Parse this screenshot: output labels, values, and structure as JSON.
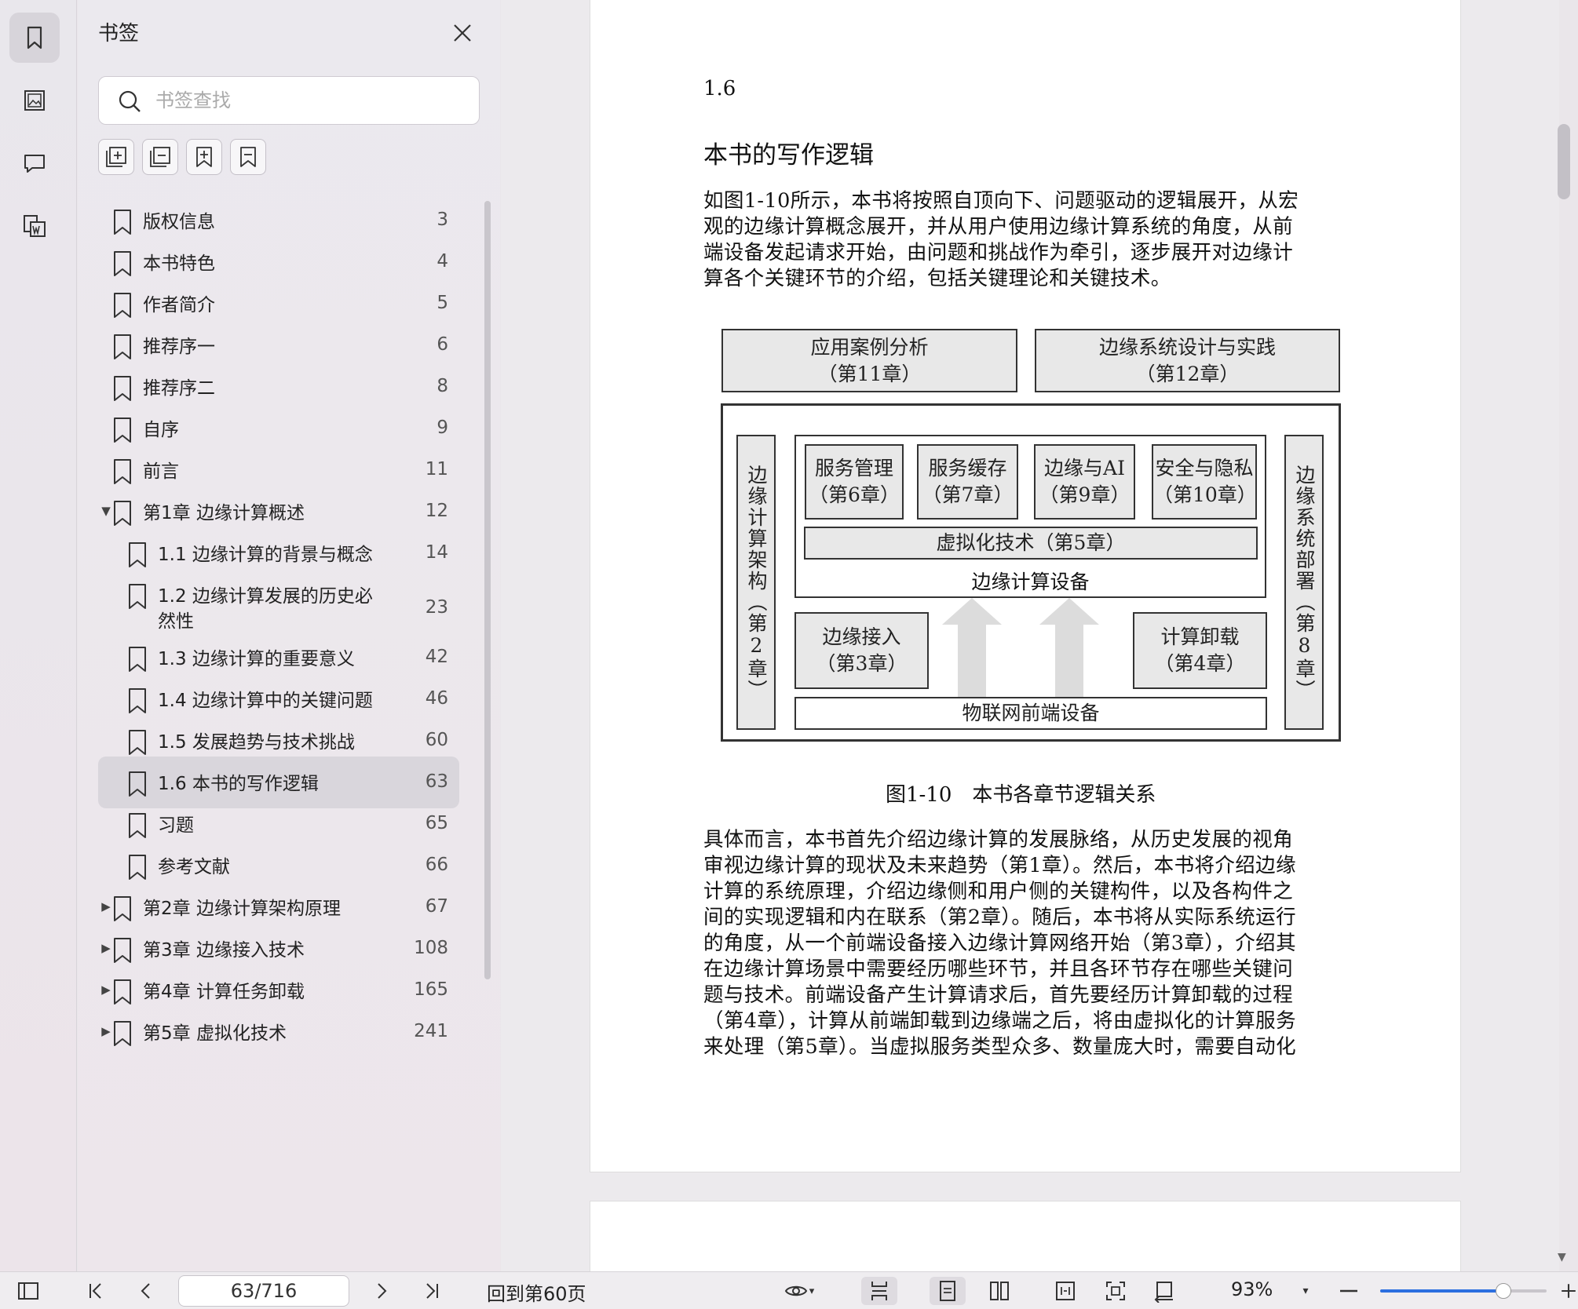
{
  "sidebar": {
    "title": "书签",
    "search_placeholder": "书签查找",
    "items": [
      {
        "label": "版权信息",
        "page": "3",
        "level": 0,
        "expander": ""
      },
      {
        "label": "本书特色",
        "page": "4",
        "level": 0,
        "expander": ""
      },
      {
        "label": "作者简介",
        "page": "5",
        "level": 0,
        "expander": ""
      },
      {
        "label": "推荐序一",
        "page": "6",
        "level": 0,
        "expander": ""
      },
      {
        "label": "推荐序二",
        "page": "8",
        "level": 0,
        "expander": ""
      },
      {
        "label": "自序",
        "page": "9",
        "level": 0,
        "expander": ""
      },
      {
        "label": "前言",
        "page": "11",
        "level": 0,
        "expander": ""
      },
      {
        "label": "第1章 边缘计算概述",
        "page": "12",
        "level": 0,
        "expander": "▼"
      },
      {
        "label": "1.1 边缘计算的背景与概念",
        "page": "14",
        "level": 1,
        "expander": ""
      },
      {
        "label": "1.2 边缘计算发展的历史必然性",
        "page": "23",
        "level": 1,
        "expander": ""
      },
      {
        "label": "1.3 边缘计算的重要意义",
        "page": "42",
        "level": 1,
        "expander": ""
      },
      {
        "label": "1.4 边缘计算中的关键问题",
        "page": "46",
        "level": 1,
        "expander": ""
      },
      {
        "label": "1.5 发展趋势与技术挑战",
        "page": "60",
        "level": 1,
        "expander": ""
      },
      {
        "label": "1.6 本书的写作逻辑",
        "page": "63",
        "level": 1,
        "expander": "",
        "selected": true
      },
      {
        "label": "习题",
        "page": "65",
        "level": 1,
        "expander": ""
      },
      {
        "label": "参考文献",
        "page": "66",
        "level": 1,
        "expander": ""
      },
      {
        "label": "第2章 边缘计算架构原理",
        "page": "67",
        "level": 0,
        "expander": "▶"
      },
      {
        "label": "第3章 边缘接入技术",
        "page": "108",
        "level": 0,
        "expander": "▶"
      },
      {
        "label": "第4章 计算任务卸载",
        "page": "165",
        "level": 0,
        "expander": "▶"
      },
      {
        "label": "第5章 虚拟化技术",
        "page": "241",
        "level": 0,
        "expander": "▶"
      }
    ]
  },
  "document": {
    "section_number": "1.6",
    "section_title": "本书的写作逻辑",
    "para1": [
      "如图1-10所示，本书将按照自顶向下、问题驱动的逻辑展开，从宏",
      "观的边缘计算概念展开，并从用户使用边缘计算系统的角度，从前",
      "端设备发起请求开始，由问题和挑战作为牵引，逐步展开对边缘计",
      "算各个关键环节的介绍，包括关键理论和关键技术。"
    ],
    "figure": {
      "top_left": {
        "line1": "应用案例分析",
        "line2": "（第11章）"
      },
      "top_right": {
        "line1": "边缘系统设计与实践",
        "line2": "（第12章）"
      },
      "left_vertical": "边缘计算架构（第2章）",
      "right_vertical": "边缘系统部署（第8章）",
      "service_mgmt": {
        "line1": "服务管理",
        "line2": "（第6章）"
      },
      "service_cache": {
        "line1": "服务缓存",
        "line2": "（第7章）"
      },
      "edge_ai": {
        "line1": "边缘与AI",
        "line2": "（第9章）"
      },
      "security": {
        "line1": "安全与隐私",
        "line2": "（第10章）"
      },
      "virtualization": "虚拟化技术（第5章）",
      "edge_device": "边缘计算设备",
      "edge_access": {
        "line1": "边缘接入",
        "line2": "（第3章）"
      },
      "offload": {
        "line1": "计算卸载",
        "line2": "（第4章）"
      },
      "iot_device": "物联网前端设备",
      "caption": "图1-10　本书各章节逻辑关系"
    },
    "para2": [
      "具体而言，本书首先介绍边缘计算的发展脉络，从历史发展的视角",
      "审视边缘计算的现状及未来趋势（第1章）。然后，本书将介绍边缘",
      "计算的系统原理，介绍边缘侧和用户侧的关键构件，以及各构件之",
      "间的实现逻辑和内在联系（第2章）。随后，本书将从实际系统运行",
      "的角度，从一个前端设备接入边缘计算网络开始（第3章），介绍其",
      "在边缘计算场景中需要经历哪些环节，并且各环节存在哪些关键问",
      "题与技术。前端设备产生计算请求后，首先要经历计算卸载的过程",
      "（第4章），计算从前端卸载到边缘端之后，将由虚拟化的计算服务",
      "来处理（第5章）。当虚拟服务类型众多、数量庞大时，需要自动化"
    ]
  },
  "toolbar": {
    "page_indicator": "63/716",
    "back_to_page": "回到第60页",
    "zoom": "93%",
    "zoom_fraction": 0.74
  }
}
